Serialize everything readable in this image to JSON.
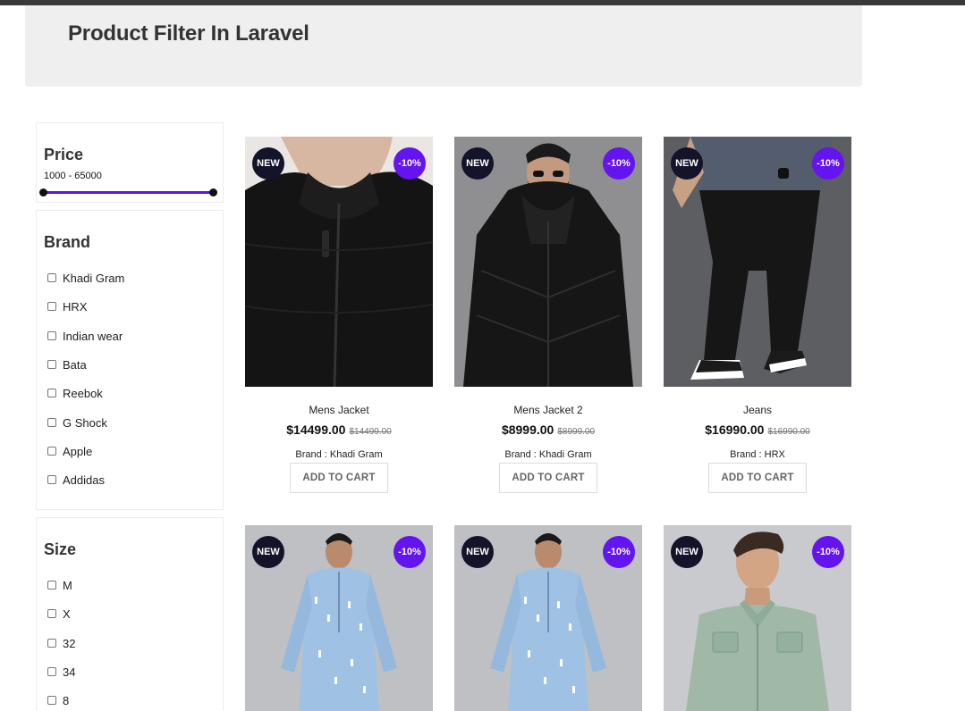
{
  "header": {
    "title": "Product Filter In Laravel"
  },
  "filters": {
    "price": {
      "title": "Price",
      "range_text": "1000 - 65000",
      "min": 1000,
      "max": 65000,
      "accent": "#5a14e6"
    },
    "brand": {
      "title": "Brand",
      "options": [
        "Khadi Gram",
        "HRX",
        "Indian wear",
        "Bata",
        "Reebok",
        "G Shock",
        "Apple",
        "Addidas"
      ]
    },
    "size": {
      "title": "Size",
      "options": [
        "M",
        "X",
        "32",
        "34",
        "8"
      ]
    }
  },
  "products": [
    {
      "badge_new": "NEW",
      "badge_sale": "-10%",
      "name": "Mens Jacket",
      "price": "$14499.00",
      "old_price": "$14499.00",
      "brand": "Brand : Khadi Gram",
      "button": "ADD TO CART"
    },
    {
      "badge_new": "NEW",
      "badge_sale": "-10%",
      "name": "Mens Jacket 2",
      "price": "$8999.00",
      "old_price": "$8999.00",
      "brand": "Brand : Khadi Gram",
      "button": "ADD TO CART"
    },
    {
      "badge_new": "NEW",
      "badge_sale": "-10%",
      "name": "Jeans",
      "price": "$16990.00",
      "old_price": "$16990.00",
      "brand": "Brand : HRX",
      "button": "ADD TO CART"
    },
    {
      "badge_new": "NEW",
      "badge_sale": "-10%"
    },
    {
      "badge_new": "NEW",
      "badge_sale": "-10%"
    },
    {
      "badge_new": "NEW",
      "badge_sale": "-10%"
    }
  ],
  "colors": {
    "accent": "#6314ef",
    "badge_new": "#13132a",
    "header_bg": "#efefef"
  }
}
